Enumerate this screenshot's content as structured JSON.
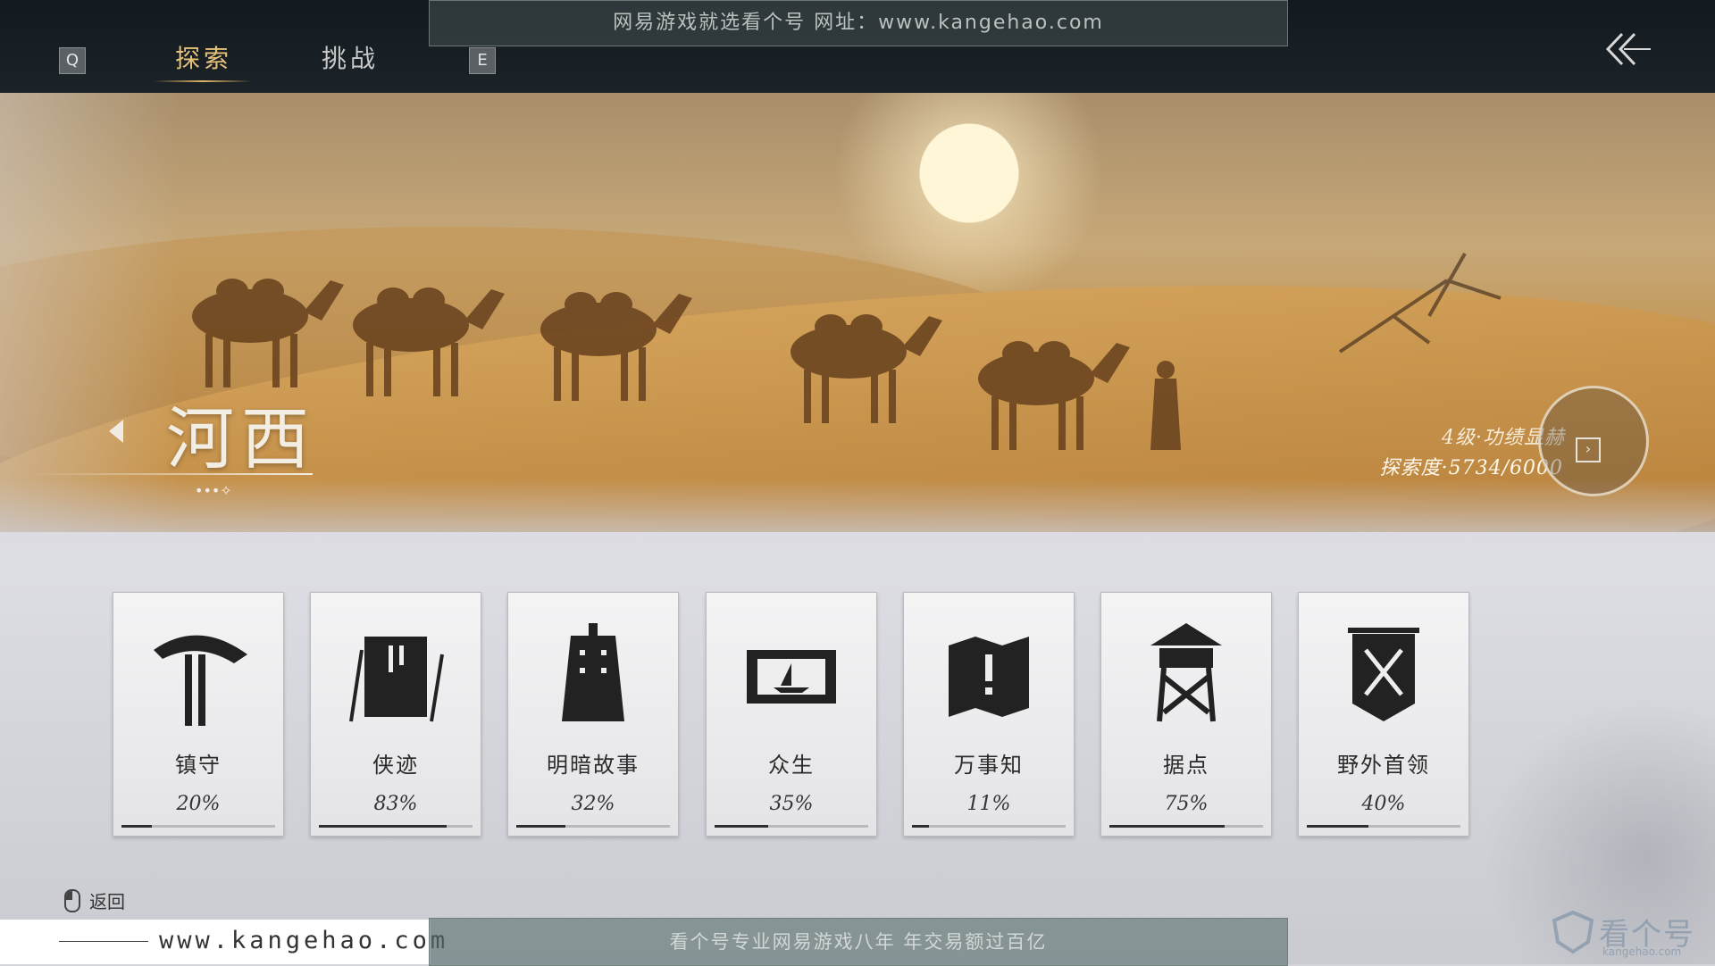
{
  "topbar": {
    "key_left": "Q",
    "key_right": "E",
    "tabs": [
      {
        "label": "探索",
        "active": true
      },
      {
        "label": "挑战",
        "active": false
      }
    ],
    "watermark": "网易游戏就选看个号   网址：www.kangehao.com"
  },
  "hero": {
    "region_name": "河西",
    "level": "4级·功绩显赫",
    "progress_label": "探索度·5734/6000",
    "progress": {
      "current": 5734,
      "max": 6000
    }
  },
  "cards": [
    {
      "label": "镇守",
      "percent": "20%",
      "value": 20,
      "icon": "straw-hat-swords-icon"
    },
    {
      "label": "侠迹",
      "percent": "83%",
      "value": 83,
      "icon": "book-bamboo-icon"
    },
    {
      "label": "明暗故事",
      "percent": "32%",
      "value": 32,
      "icon": "bell-icon"
    },
    {
      "label": "众生",
      "percent": "35%",
      "value": 35,
      "icon": "scroll-boat-icon"
    },
    {
      "label": "万事知",
      "percent": "11%",
      "value": 11,
      "icon": "map-exclamation-icon"
    },
    {
      "label": "据点",
      "percent": "75%",
      "value": 75,
      "icon": "watchtower-icon"
    },
    {
      "label": "野外首领",
      "percent": "40%",
      "value": 40,
      "icon": "crossed-swords-banner-icon"
    }
  ],
  "footer": {
    "return_label": "返回",
    "site": "www.kangehao.com",
    "banner": "看个号专业网易游戏八年   年交易额过百亿",
    "logo_big": "看个号",
    "logo_small": "kangehao.com"
  },
  "colors": {
    "accent": "#e8c27a",
    "topbar": "#161d22",
    "card_bg": "#ececee",
    "bar_fill": "#2e2e30"
  }
}
